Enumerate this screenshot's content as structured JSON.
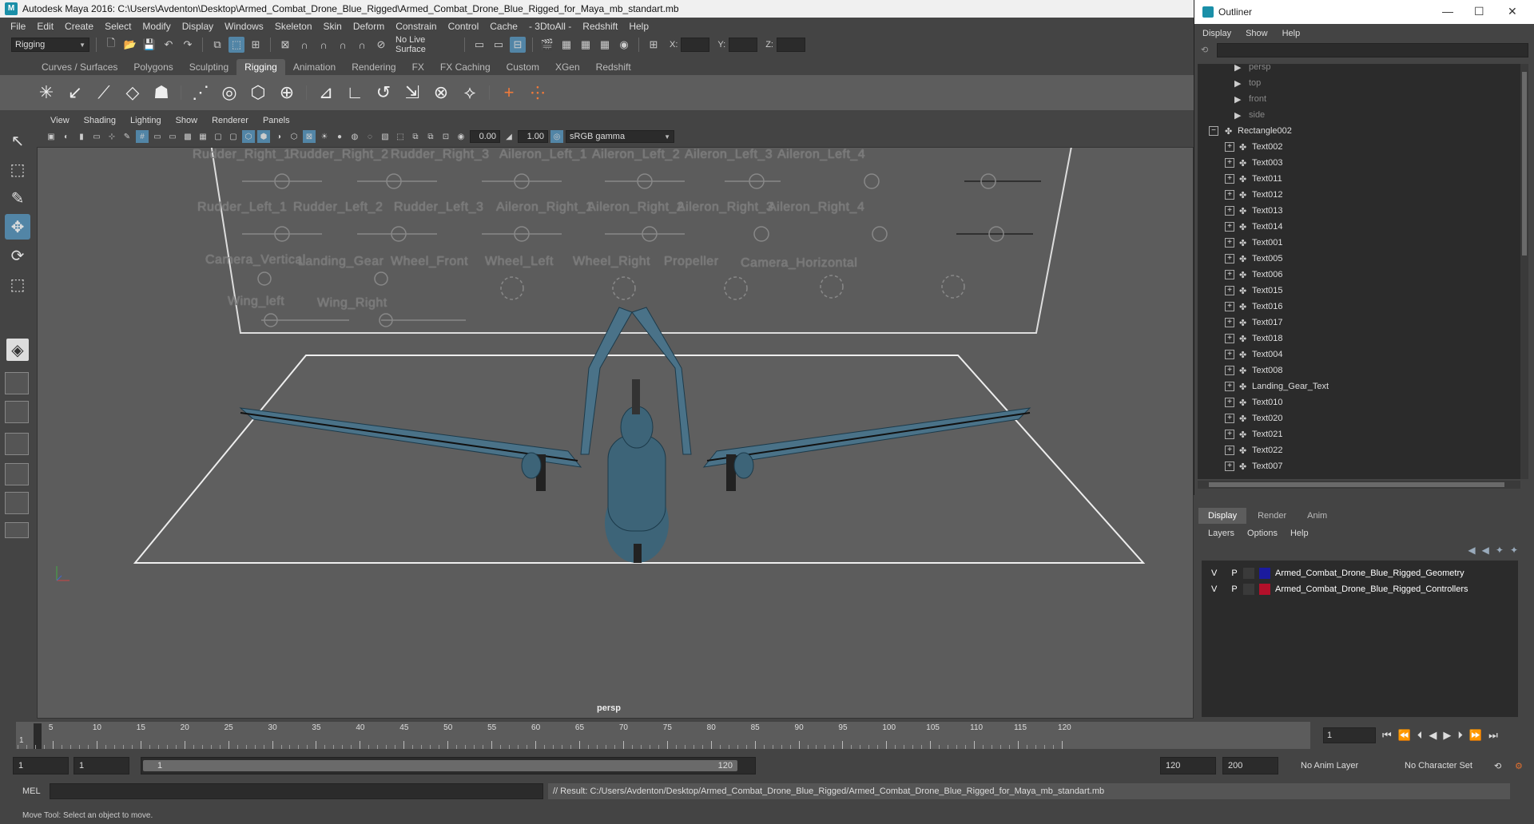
{
  "window": {
    "title": "Autodesk Maya 2016: C:\\Users\\Avdenton\\Desktop\\Armed_Combat_Drone_Blue_Rigged\\Armed_Combat_Drone_Blue_Rigged_for_Maya_mb_standart.mb"
  },
  "menubar": [
    "File",
    "Edit",
    "Create",
    "Select",
    "Modify",
    "Display",
    "Windows",
    "Skeleton",
    "Skin",
    "Deform",
    "Constrain",
    "Control",
    "Cache",
    "- 3DtoAll -",
    "Redshift",
    "Help"
  ],
  "statusline": {
    "mode": "Rigging",
    "live_surface": "No Live Surface",
    "x_label": "X:",
    "y_label": "Y:",
    "z_label": "Z:"
  },
  "shelf": {
    "tabs": [
      "Curves / Surfaces",
      "Polygons",
      "Sculpting",
      "Rigging",
      "Animation",
      "Rendering",
      "FX",
      "FX Caching",
      "Custom",
      "XGen",
      "Redshift"
    ],
    "active_tab": "Rigging"
  },
  "panel": {
    "menu": [
      "View",
      "Shading",
      "Lighting",
      "Show",
      "Renderer",
      "Panels"
    ],
    "exposure": "0.00",
    "gamma": "1.00",
    "color_space": "sRGB gamma",
    "camera": "persp"
  },
  "controls": {
    "row1": [
      "Rudder_Right_1",
      "Rudder_Right_2",
      "Rudder_Right_3",
      "Aileron_Left_1",
      "Aileron_Left_2",
      "Aileron_Left_3",
      "Aileron_Left_4"
    ],
    "row2": [
      "Rudder_Left_1",
      "Rudder_Left_2",
      "Rudder_Left_3",
      "Aileron_Right_1",
      "Aileron_Right_2",
      "Aileron_Right_3",
      "Aileron_Right_4"
    ],
    "row3": [
      "Camera_Vertical",
      "Landing_Gear",
      "Wheel_Front",
      "Wheel_Left",
      "Wheel_Right",
      "Propeller",
      "Camera_Horizontal"
    ],
    "row4": [
      "Wing_left",
      "Wing_Right"
    ]
  },
  "timeline": {
    "ticks": [
      "5",
      "10",
      "15",
      "20",
      "25",
      "30",
      "35",
      "40",
      "45",
      "50",
      "55",
      "60",
      "65",
      "70",
      "75",
      "80",
      "85",
      "90",
      "95",
      "100",
      "105",
      "110",
      "115",
      "120"
    ],
    "current_frame": "1",
    "current_field": "1"
  },
  "range": {
    "start": "1",
    "anim_start": "1",
    "slider_start": "1",
    "slider_end": "120",
    "end": "120",
    "anim_end": "200",
    "anim_layer": "No Anim Layer",
    "character_set": "No Character Set"
  },
  "command": {
    "mel_label": "MEL",
    "result": "// Result: C:/Users/Avdenton/Desktop/Armed_Combat_Drone_Blue_Rigged/Armed_Combat_Drone_Blue_Rigged_for_Maya_mb_standart.mb"
  },
  "help_line": "Move Tool: Select an object to move.",
  "outliner": {
    "title": "Outliner",
    "menu": [
      "Display",
      "Show",
      "Help"
    ],
    "cameras": [
      "persp",
      "top",
      "front",
      "side"
    ],
    "group": "Rectangle002",
    "children": [
      "Text002",
      "Text003",
      "Text011",
      "Text012",
      "Text013",
      "Text014",
      "Text001",
      "Text005",
      "Text006",
      "Text015",
      "Text016",
      "Text017",
      "Text018",
      "Text004",
      "Text008",
      "Landing_Gear_Text",
      "Text010",
      "Text020",
      "Text021",
      "Text022",
      "Text007"
    ]
  },
  "layer_editor": {
    "tabs": [
      "Display",
      "Render",
      "Anim"
    ],
    "active_tab": "Display",
    "menu": [
      "Layers",
      "Options",
      "Help"
    ],
    "layers": [
      {
        "v": "V",
        "p": "P",
        "name": "Armed_Combat_Drone_Blue_Rigged_Geometry",
        "color": "#1b1b9e"
      },
      {
        "v": "V",
        "p": "P",
        "name": "Armed_Combat_Drone_Blue_Rigged_Controllers",
        "color": "#b3102a"
      }
    ]
  },
  "colors": {
    "accent": "#5285a6",
    "drone_body": "#3d6478",
    "viewport_bg": "#5c5c5c"
  }
}
